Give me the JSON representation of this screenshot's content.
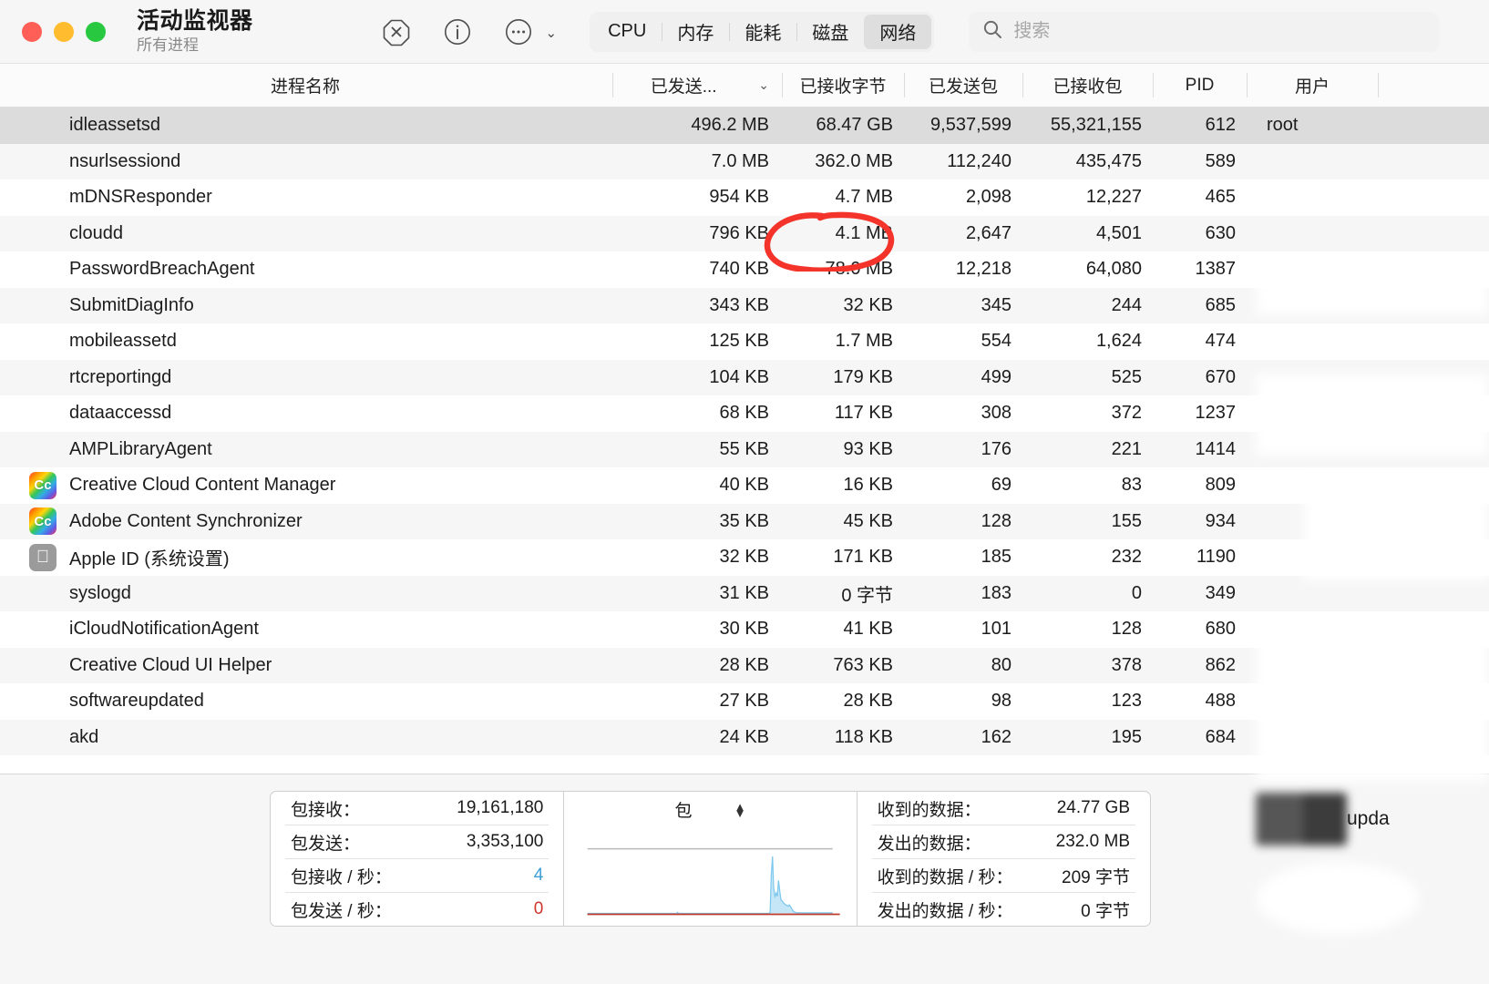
{
  "window": {
    "title": "活动监视器",
    "subtitle": "所有进程",
    "traffic_colors": {
      "close": "#ff5f57",
      "minimize": "#febc2e",
      "zoom": "#28c840"
    }
  },
  "toolbar": {
    "stop_icon": "stop-process-icon",
    "info_icon": "inspect-process-icon",
    "more_icon": "more-options-icon",
    "chevron": "⌄",
    "tabs": [
      {
        "label": "CPU",
        "active": false
      },
      {
        "label": "内存",
        "active": false
      },
      {
        "label": "能耗",
        "active": false
      },
      {
        "label": "磁盘",
        "active": false
      },
      {
        "label": "网络",
        "active": true
      }
    ],
    "search": {
      "placeholder": "搜索",
      "value": "",
      "icon": "search-icon"
    }
  },
  "table": {
    "columns": {
      "name": "进程名称",
      "sent_bytes": "已发送...",
      "recv_bytes": "已接收字节",
      "sent_packets": "已发送包",
      "recv_packets": "已接收包",
      "pid": "PID",
      "user": "用户"
    },
    "sort_indicator": "⌄",
    "rows": [
      {
        "icon": "none",
        "name": "idleassetsd",
        "sent": "496.2 MB",
        "recv": "68.47 GB",
        "sentp": "9,537,599",
        "recvp": "55,321,155",
        "pid": "612",
        "user": "root",
        "selected": true
      },
      {
        "icon": "none",
        "name": "nsurlsessiond",
        "sent": "7.0 MB",
        "recv": "362.0 MB",
        "sentp": "112,240",
        "recvp": "435,475",
        "pid": "589",
        "user": "",
        "selected": false
      },
      {
        "icon": "none",
        "name": "mDNSResponder",
        "sent": "954 KB",
        "recv": "4.7 MB",
        "sentp": "2,098",
        "recvp": "12,227",
        "pid": "465",
        "user": "",
        "selected": false
      },
      {
        "icon": "none",
        "name": "cloudd",
        "sent": "796 KB",
        "recv": "4.1 MB",
        "sentp": "2,647",
        "recvp": "4,501",
        "pid": "630",
        "user": "",
        "selected": false
      },
      {
        "icon": "none",
        "name": "PasswordBreachAgent",
        "sent": "740 KB",
        "recv": "78.0 MB",
        "sentp": "12,218",
        "recvp": "64,080",
        "pid": "1387",
        "user": "",
        "selected": false
      },
      {
        "icon": "none",
        "name": "SubmitDiagInfo",
        "sent": "343 KB",
        "recv": "32 KB",
        "sentp": "345",
        "recvp": "244",
        "pid": "685",
        "user": "",
        "selected": false
      },
      {
        "icon": "none",
        "name": "mobileassetd",
        "sent": "125 KB",
        "recv": "1.7 MB",
        "sentp": "554",
        "recvp": "1,624",
        "pid": "474",
        "user": "",
        "selected": false
      },
      {
        "icon": "none",
        "name": "rtcreportingd",
        "sent": "104 KB",
        "recv": "179 KB",
        "sentp": "499",
        "recvp": "525",
        "pid": "670",
        "user": "",
        "selected": false
      },
      {
        "icon": "none",
        "name": "dataaccessd",
        "sent": "68 KB",
        "recv": "117 KB",
        "sentp": "308",
        "recvp": "372",
        "pid": "1237",
        "user": "",
        "selected": false
      },
      {
        "icon": "none",
        "name": "AMPLibraryAgent",
        "sent": "55 KB",
        "recv": "93 KB",
        "sentp": "176",
        "recvp": "221",
        "pid": "1414",
        "user": "",
        "selected": false
      },
      {
        "icon": "creative-cloud",
        "name": "Creative Cloud Content Manager",
        "sent": "40 KB",
        "recv": "16 KB",
        "sentp": "69",
        "recvp": "83",
        "pid": "809",
        "user": "",
        "selected": false
      },
      {
        "icon": "creative-cloud",
        "name": "Adobe Content Synchronizer",
        "sent": "35 KB",
        "recv": "45 KB",
        "sentp": "128",
        "recvp": "155",
        "pid": "934",
        "user": "",
        "selected": false
      },
      {
        "icon": "apple",
        "name": "Apple ID (系统设置)",
        "sent": "32 KB",
        "recv": "171 KB",
        "sentp": "185",
        "recvp": "232",
        "pid": "1190",
        "user": "",
        "selected": false
      },
      {
        "icon": "none",
        "name": "syslogd",
        "sent": "31 KB",
        "recv": "0 字节",
        "sentp": "183",
        "recvp": "0",
        "pid": "349",
        "user": "",
        "selected": false
      },
      {
        "icon": "none",
        "name": "iCloudNotificationAgent",
        "sent": "30 KB",
        "recv": "41 KB",
        "sentp": "101",
        "recvp": "128",
        "pid": "680",
        "user": "",
        "selected": false
      },
      {
        "icon": "none",
        "name": "Creative Cloud UI Helper",
        "sent": "28 KB",
        "recv": "763 KB",
        "sentp": "80",
        "recvp": "378",
        "pid": "862",
        "user": "",
        "selected": false
      },
      {
        "icon": "none",
        "name": "softwareupdated",
        "sent": "27 KB",
        "recv": "28 KB",
        "sentp": "98",
        "recvp": "123",
        "pid": "488",
        "user": "",
        "selected": false
      },
      {
        "icon": "none",
        "name": "akd",
        "sent": "24 KB",
        "recv": "118 KB",
        "sentp": "162",
        "recvp": "195",
        "pid": "684",
        "user": "",
        "selected": false
      }
    ]
  },
  "annotation": {
    "type": "hand-drawn-circle",
    "color": "#f4332a",
    "targets_value": "68.47 GB"
  },
  "overlay": {
    "partial_text": "upda"
  },
  "stats": {
    "left": [
      {
        "key": "包接收：",
        "value": "19,161,180",
        "color": "default"
      },
      {
        "key": "包发送：",
        "value": "3,353,100",
        "color": "default"
      },
      {
        "key": "包接收 / 秒：",
        "value": "4",
        "color": "blue"
      },
      {
        "key": "包发送 / 秒：",
        "value": "0",
        "color": "red"
      }
    ],
    "graph": {
      "mode_label": "包",
      "stepper_icon": "up-down-stepper-icon"
    },
    "right": [
      {
        "key": "收到的数据：",
        "value": "24.77 GB",
        "color": "default"
      },
      {
        "key": "发出的数据：",
        "value": "232.0 MB",
        "color": "default"
      },
      {
        "key": "收到的数据 / 秒：",
        "value": "209 字节",
        "color": "default"
      },
      {
        "key": "发出的数据 / 秒：",
        "value": "0 字节",
        "color": "default"
      }
    ]
  },
  "chart_data": {
    "type": "area",
    "title": "包",
    "series": [
      {
        "name": "包接收 / 秒",
        "color": "#7ec8ed",
        "values": [
          0,
          0,
          0,
          0,
          0,
          0,
          0,
          0,
          0,
          0,
          0,
          0,
          0,
          0,
          0,
          0,
          0,
          0,
          0,
          0,
          0,
          0,
          0,
          0,
          0,
          0,
          0,
          0,
          0,
          0,
          0,
          0,
          0,
          0,
          0,
          0,
          0,
          0,
          0,
          0,
          0,
          0,
          0,
          0,
          0,
          0,
          0,
          0,
          0,
          0,
          0,
          0,
          0,
          0,
          0,
          0,
          0,
          0,
          0,
          0,
          0,
          0,
          0,
          0,
          0,
          0,
          0,
          0,
          0,
          0,
          0,
          0,
          0,
          0,
          0,
          2,
          0,
          0,
          0,
          0,
          0,
          0,
          0,
          0,
          0,
          0,
          0,
          0,
          0,
          0,
          0,
          0,
          0,
          0,
          0,
          0,
          0,
          0,
          0,
          0,
          0,
          0,
          0,
          0,
          0,
          0,
          0,
          0,
          0,
          0,
          0,
          0,
          0,
          0,
          0,
          0,
          0,
          0,
          0,
          0,
          0,
          0,
          0,
          0,
          0,
          0,
          0,
          0,
          0,
          0,
          0,
          0,
          0,
          0,
          0,
          0,
          0,
          0,
          0,
          0,
          0,
          0,
          0,
          0,
          0,
          0,
          0,
          0,
          0,
          0,
          0,
          0,
          2,
          68,
          100,
          44,
          30,
          36,
          30,
          58,
          40,
          24,
          22,
          19,
          17,
          15,
          14,
          13,
          15,
          12,
          8,
          5,
          3,
          2,
          1,
          1,
          1,
          1,
          1,
          1,
          1,
          1,
          1,
          1,
          1,
          1,
          1,
          1,
          1,
          1,
          1,
          1,
          1,
          1,
          1,
          1,
          1,
          1,
          1,
          1,
          1,
          1,
          1,
          1,
          1
        ]
      },
      {
        "name": "包发送 / 秒",
        "color": "#c0392b",
        "values": [
          0,
          0,
          0,
          0,
          0,
          0,
          0,
          0,
          0,
          0,
          0,
          0,
          0,
          0,
          0,
          0,
          0,
          0,
          0,
          0,
          0,
          0,
          0,
          0,
          0,
          0,
          0,
          0,
          0,
          0,
          0,
          0,
          0,
          0,
          0,
          0,
          0,
          0,
          0,
          0,
          0,
          0,
          0,
          0,
          0,
          0,
          0,
          0,
          0,
          0,
          0,
          0,
          0,
          0,
          0,
          0,
          0,
          0,
          0,
          0,
          0,
          0,
          0,
          0,
          0,
          0,
          0,
          0,
          0,
          0,
          0,
          0,
          0,
          0,
          0,
          0,
          0,
          0,
          0,
          0,
          0,
          0,
          0,
          0,
          0,
          0,
          0,
          0,
          0,
          0,
          0,
          0,
          0,
          0,
          0,
          0,
          0,
          0,
          0,
          0,
          0,
          0,
          0,
          0,
          0,
          0,
          0,
          0,
          0,
          0,
          0,
          0,
          0,
          0,
          0,
          0,
          0,
          0,
          0,
          0,
          0,
          0,
          0,
          0,
          0,
          0,
          0,
          0,
          0,
          0,
          0,
          0,
          0,
          0,
          0,
          0,
          0,
          0,
          0,
          0,
          0,
          0,
          0,
          0,
          0,
          0,
          0,
          0,
          0,
          0,
          0,
          0,
          0,
          0,
          0,
          0,
          0,
          0,
          0,
          0,
          0,
          0,
          0,
          0,
          0,
          0,
          0,
          0,
          0,
          0,
          0,
          0,
          0,
          0,
          0,
          0,
          0,
          0,
          0,
          0,
          0,
          0,
          0,
          0,
          0,
          0,
          0,
          0,
          0,
          0,
          0,
          0,
          0,
          0,
          0,
          0,
          0,
          0,
          0,
          0,
          0,
          0,
          0,
          0,
          0,
          0,
          0,
          0,
          0,
          0,
          0
        ]
      }
    ],
    "ylim": [
      0,
      110
    ],
    "grid": false,
    "legend": "none"
  }
}
